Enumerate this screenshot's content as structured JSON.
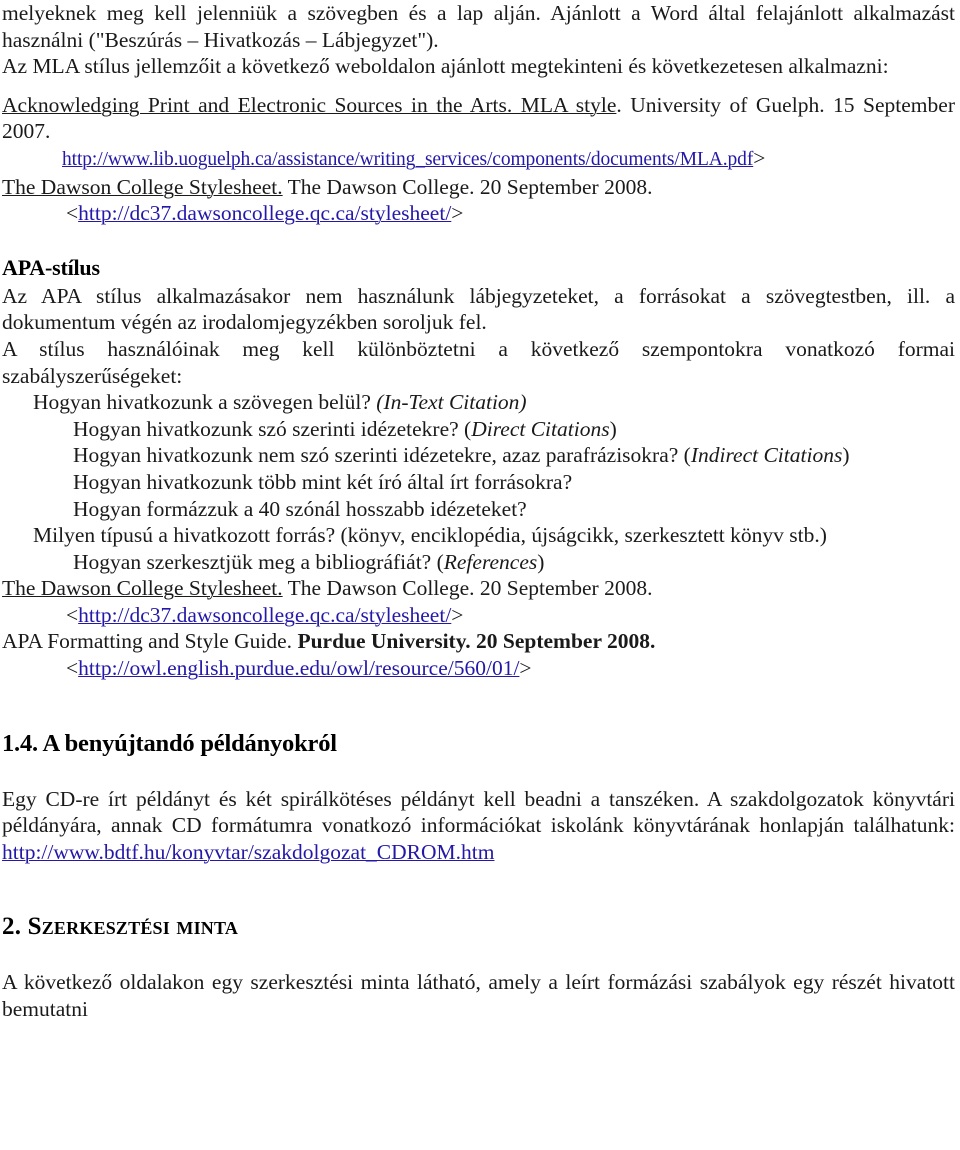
{
  "document": {
    "language": "hu",
    "paragraph_1": "melyeknek meg kell jelenniük a szövegben és a lap alján. Ajánlott a Word által felajánlott alkalmazást használni (\"Beszúrás – Hivatkozás – Lábjegyzet\").",
    "paragraph_2": "Az MLA stílus jellemzőit a következő weboldalon ajánlott megtekinteni és következetesen alkalmazni:",
    "mla_references": {
      "ref1_title": "Acknowledging Print and Electronic Sources in the Arts. MLA style",
      "ref1_rest": ". University of Guelph. 15 September 2007.",
      "ref1_url": "http://www.lib.uoguelph.ca/assistance/writing_services/components/documents/MLA.pdf",
      "ref1_url_close": ">",
      "ref2_title": "The Dawson College Stylesheet.",
      "ref2_rest": " The Dawson College. 20 September 2008.",
      "ref2_url_open": "<",
      "ref2_url": "http://dc37.dawsoncollege.qc.ca/stylesheet/",
      "ref2_url_close": ">"
    },
    "apa_section": {
      "heading": "APA-stílus",
      "paragraph_1": "Az APA stílus alkalmazásakor nem használunk lábjegyzeteket, a forrásokat a szövegtestben, ill. a dokumentum végén az irodalomjegyzékben soroljuk fel.",
      "paragraph_2": "A stílus használóinak meg kell különböztetni a következő szempontokra vonatkozó formai szabályszerűségeket:",
      "questions": [
        {
          "indent": 1,
          "text": "Hogyan hivatkozunk a szövegen belül? ",
          "em": "(In-Text Citation)",
          "em_style": "italic"
        },
        {
          "indent": 2,
          "text": "Hogyan hivatkozunk szó szerinti idézetekre? (",
          "em": "Direct Citations",
          "suffix": ")"
        },
        {
          "indent": 2,
          "text": "Hogyan hivatkozunk nem szó szerinti idézetekre, azaz parafrázisokra? (",
          "em": "Indirect Citations",
          "suffix": ")"
        },
        {
          "indent": 2,
          "text": "Hogyan hivatkozunk több mint két író által írt forrásokra?",
          "em": "",
          "suffix": ""
        },
        {
          "indent": 2,
          "text": "Hogyan formázzuk a 40 szónál hosszabb idézeteket?",
          "em": "",
          "suffix": ""
        },
        {
          "indent": 1,
          "text": "Milyen típusú a hivatkozott forrás? (könyv, enciklopédia, újságcikk, szerkesztett könyv stb.)",
          "em": "",
          "suffix": ""
        },
        {
          "indent": 2,
          "text": "Hogyan szerkesztjük meg a bibliográfiát? (",
          "em": "References",
          "suffix": ")"
        }
      ],
      "references": {
        "ref1_title": "The Dawson College Stylesheet.",
        "ref1_rest": " The Dawson College. 20 September 2008.",
        "ref1_url_open": "<",
        "ref1_url": "http://dc37.dawsoncollege.qc.ca/stylesheet/",
        "ref1_url_close": ">",
        "ref2_title": "APA Formatting and Style Guide. ",
        "ref2_bold": "Purdue University. 20 September 2008.",
        "ref2_url_open": "<",
        "ref2_url": "http://owl.english.purdue.edu/owl/resource/560/01/",
        "ref2_url_close": ">"
      }
    },
    "section_1_4": {
      "heading": "1.4. A benyújtandó példányokról",
      "paragraph_prefix": "Egy CD-re írt példányt és két spirálkötéses példányt kell beadni a tanszéken. A szakdolgozatok könyvtári példányára, annak CD formátumra vonatkozó információkat iskolánk könyvtárának honlapján találhatunk: ",
      "url": "http://www.bdtf.hu/konyvtar/szakdolgozat_CDROM.htm"
    },
    "section_2": {
      "heading": "2. Szerkesztési minta",
      "paragraph": "A következő oldalakon egy szerkesztési minta látható, amely a leírt formázási szabályok egy részét hivatott bemutatni"
    }
  },
  "colors": {
    "text": "#1a1a1a",
    "link": "#2318a8",
    "background": "#ffffff"
  }
}
